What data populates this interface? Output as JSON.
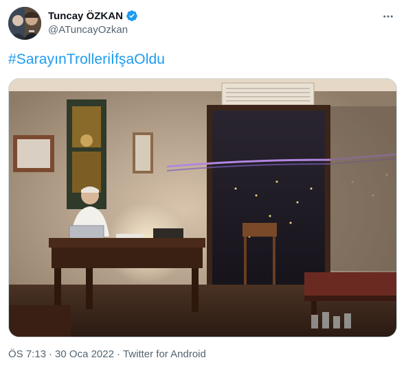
{
  "author": {
    "display_name": "Tuncay ÖZKAN",
    "handle": "@ATuncayOzkan",
    "verified": true
  },
  "tweet": {
    "hashtag": "#SarayınTrolleriİfşaOldu"
  },
  "media": {
    "type": "photo"
  },
  "meta": {
    "time": "ÖS 7:13",
    "separator": "·",
    "date": "30 Oca 2022",
    "source": "Twitter for Android"
  },
  "icons": {
    "verified": "verified-badge-icon",
    "more": "more-options-icon"
  },
  "colors": {
    "link": "#1d9bf0",
    "secondary_text": "#536471",
    "verified": "#1d9bf0"
  }
}
